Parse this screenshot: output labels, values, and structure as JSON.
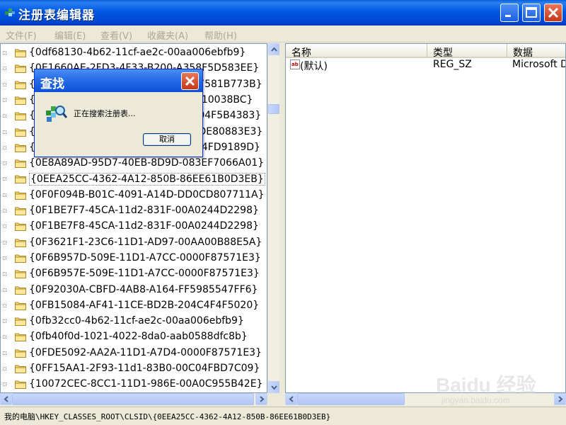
{
  "window": {
    "title": "注册表编辑器"
  },
  "menu": [
    "文件(F)",
    "编辑(E)",
    "查看(V)",
    "收藏夹(A)",
    "帮助(H)"
  ],
  "tree": {
    "keys": [
      "{0df68130-4b62-11cf-ae2c-00aa006ebfb9}",
      "{0E1660AE-2FD3-4F33-B200-A358F5D583EE}",
      "{0E1C7E8E-DFEB-4A36-AD42-95E7581B773B}",
      "{0E41F1A6-E6C0-4D03-8F4F-A2EE10038BC}",
      "{0E4B2E30-1E7C-11D0-A1C0-00C04F5B4383}",
      "{0E5AAE11-A475-4C5B-AB00-C66DE80883E3}",
      "{0E890F83-5F79-11D1-9043-00C04FD9189D}",
      "{0E8A89AD-95D7-40EB-8D9D-083EF7066A01}",
      "{0EEA25CC-4362-4A12-850B-86EE61B0D3EB}",
      "{0F0F094B-B01C-4091-A14D-DD0CD807711A}",
      "{0F1BE7F7-45CA-11d2-831F-00A0244D2298}",
      "{0F1BE7F8-45CA-11d2-831F-00A0244D2298}",
      "{0F3621F1-23C6-11D1-AD97-00AA00B88E5A}",
      "{0F6B957D-509E-11D1-A7CC-0000F87571E3}",
      "{0F6B957E-509E-11D1-A7CC-0000F87571E3}",
      "{0F92030A-CBFD-4AB8-A164-FF5985547FF6}",
      "{0FB15084-AF41-11CE-BD2B-204C4F4F5020}",
      "{0fb32cc0-4b62-11cf-ae2c-00aa006ebfb9}",
      "{0fb40f0d-1021-4022-8da0-aab0588dfc8b}",
      "{0FDE5092-AA2A-11D1-A7D4-0000F87571E3}",
      "{0FF15AA1-2F93-11d1-83B0-00C04FBD7C09}",
      "{10072CEC-8CC1-11D1-986E-00A0C955B42E}"
    ]
  },
  "list": {
    "headers": [
      "名称",
      "类型",
      "数据"
    ],
    "rows": [
      {
        "name": "(默认)",
        "type": "REG_SZ",
        "data": "Microsoft D"
      }
    ]
  },
  "status": {
    "path": "我的电脑\\HKEY_CLASSES_ROOT\\CLSID\\{0EEA25CC-4362-4A12-850B-86EE61B0D3EB}"
  },
  "dialog": {
    "title": "查找",
    "message": "正在搜索注册表...",
    "cancel": "取消"
  },
  "watermark": {
    "brand": "Baidu 经验",
    "sub": "jingyan.baidu.com"
  },
  "colors": {
    "title_blue": "#0058e6",
    "close_red": "#c4381b",
    "folder_yellow": "#f5d76e"
  }
}
